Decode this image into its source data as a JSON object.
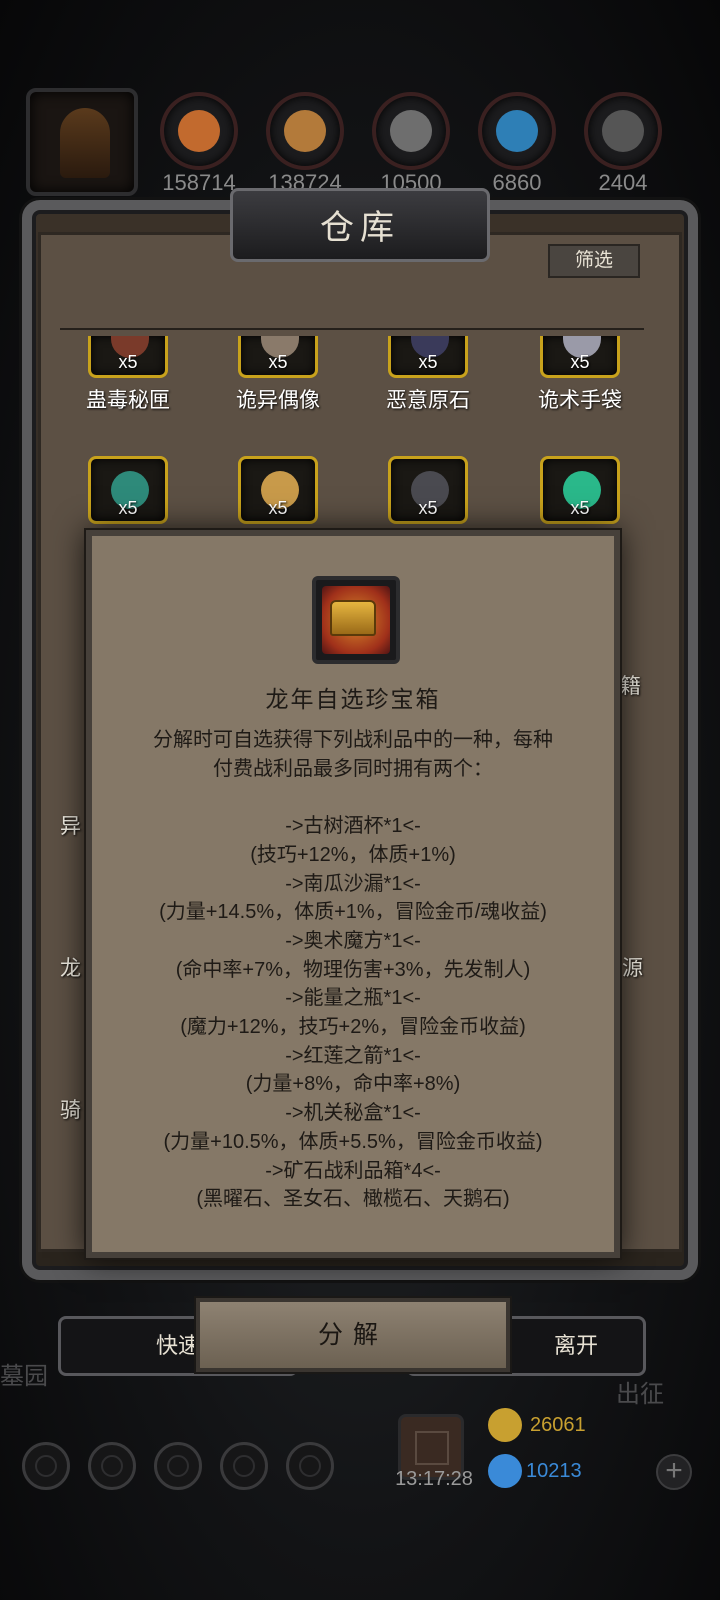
{
  "resources": [
    {
      "value": "158714",
      "color": "#c26a2e"
    },
    {
      "value": "138724",
      "color": "#b37a3a"
    },
    {
      "value": "10500",
      "color": "#6e6e6e"
    },
    {
      "value": "6860",
      "color": "#2e7fb6"
    },
    {
      "value": "2404",
      "color": "#555555"
    }
  ],
  "warehouse": {
    "title": "仓库",
    "filter_label": "筛选"
  },
  "items_row1": [
    {
      "name": "蛊毒秘匣",
      "qty": "x5",
      "color": "#7a3a2a"
    },
    {
      "name": "诡异偶像",
      "qty": "x5",
      "color": "#8a7a6a"
    },
    {
      "name": "恶意原石",
      "qty": "x5",
      "color": "#3a3a5a"
    },
    {
      "name": "诡术手袋",
      "qty": "x5",
      "color": "#9a9aa8"
    }
  ],
  "items_row2": [
    {
      "qty": "x5",
      "color": "#2e8a7a"
    },
    {
      "qty": "x5",
      "color": "#c89a4a"
    },
    {
      "qty": "x5",
      "color": "#4a4a50"
    },
    {
      "qty": "x5",
      "color": "#2ab88a"
    }
  ],
  "side_labels": {
    "right_1": "籍",
    "left_2": "异",
    "left_3": "龙",
    "right_3": "源",
    "left_4": "骑"
  },
  "modal": {
    "title": "龙年自选珍宝箱",
    "intro": [
      "分解时可自选获得下列战利品中的一种，每种",
      "付费战利品最多同时拥有两个："
    ],
    "rewards": [
      "->古树酒杯*1<-",
      "(技巧+12%，体质+1%)",
      "->南瓜沙漏*1<-",
      "(力量+14.5%，体质+1%，冒险金币/魂收益)",
      "->奥术魔方*1<-",
      "(命中率+7%，物理伤害+3%，先发制人)",
      "->能量之瓶*1<-",
      "(魔力+12%，技巧+2%，冒险金币收益)",
      "->红莲之箭*1<-",
      "(力量+8%，命中率+8%)",
      "->机关秘盒*1<-",
      "(力量+10.5%，体质+5.5%，冒险金币收益)",
      "->矿石战利品箱*4<-",
      "(黑曜石、圣女石、橄榄石、天鹅石)"
    ]
  },
  "buttons": {
    "quick": "快速",
    "decompose": "分解",
    "leave": "离开"
  },
  "bottom": {
    "left_label": "墓园",
    "right_label": "出征",
    "timer": "13:17:28",
    "gold": "26061",
    "gems": "10213",
    "gold_color": "#c8a030",
    "gem_color": "#3a8ad8"
  }
}
